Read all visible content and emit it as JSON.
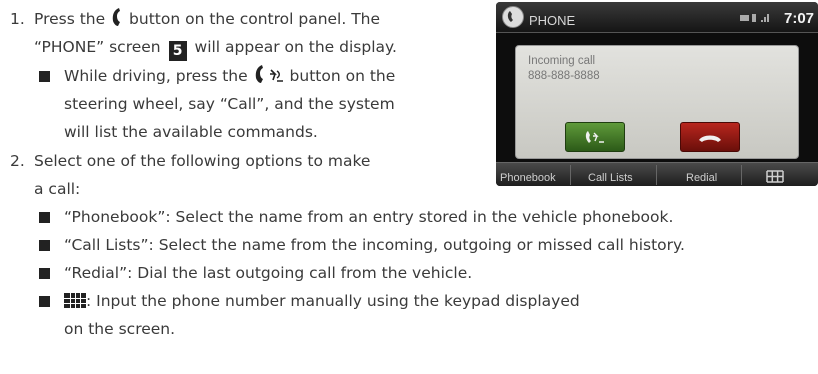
{
  "steps": [
    {
      "number": "1.",
      "line1_a": "Press the",
      "line1_b": "button on the control panel. The",
      "line2_a": "“PHONE” screen",
      "screen_ref": "5",
      "line2_b": "will appear on the display.",
      "sub": {
        "line1_a": "While driving, press the",
        "line1_b": "button on the",
        "line2": "steering wheel, say “Call”, and the system",
        "line3": "will list the available commands."
      }
    },
    {
      "number": "2.",
      "line1": "Select one of the following options to make",
      "line2": "a call:",
      "options": [
        "“Phonebook”: Select the name from an entry stored in the vehicle phonebook.",
        "“Call Lists”: Select the name from the incoming, outgoing or missed call history.",
        "“Redial”: Dial the last outgoing call from the vehicle."
      ],
      "keypad_option": {
        "line1": ": Input the phone number manually using the keypad displayed",
        "line2": "on the screen."
      }
    }
  ],
  "screen": {
    "title": "PHONE",
    "clock": "7:07",
    "incoming_label": "Incoming call",
    "incoming_number": "888-888-8888",
    "tabs": [
      "Phonebook",
      "Call Lists",
      "Redial"
    ],
    "accept_color": "#3f7a26",
    "decline_color": "#9a1a14"
  },
  "icons": {
    "phone_button": "phone-handset-icon",
    "steering_phone_voice_button": "phone-voice-icon",
    "keypad": "keypad-grid-icon"
  }
}
